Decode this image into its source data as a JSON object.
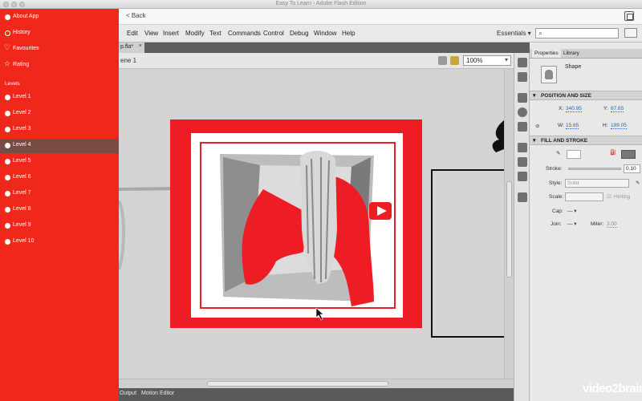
{
  "window": {
    "title": "Easy To Learn - Adobe Flash Edition"
  },
  "nav": {
    "back_label": "< Back"
  },
  "menu": {
    "items": [
      "Edit",
      "View",
      "Insert",
      "Modify",
      "Text",
      "Commands",
      "Control",
      "Debug",
      "Window",
      "Help"
    ],
    "workspace": "Essentials ▾",
    "search_placeholder": ""
  },
  "document": {
    "tab_label": "p.fla*",
    "close_glyph": "×",
    "scene_label": "ene 1",
    "zoom": "100%"
  },
  "stage": {
    "accent": "#ee1c25",
    "play_glyph": "▶"
  },
  "bottom_tabs": [
    "Output",
    "Motion Editor"
  ],
  "sidebar": {
    "top_items": [
      {
        "label": "About App",
        "icon": "info-icon"
      },
      {
        "label": "History",
        "icon": "clock-icon"
      },
      {
        "label": "Favourites",
        "icon": "heart-icon"
      },
      {
        "label": "Rating",
        "icon": "star-icon"
      }
    ],
    "section_title": "Levels",
    "levels": [
      "Level 1",
      "Level 2",
      "Level 3",
      "Level 4",
      "Level 5",
      "Level 6",
      "Level 7",
      "Level 8",
      "Level 9",
      "Level 10"
    ],
    "active_level": "Level 4",
    "color": "#f0281c"
  },
  "properties": {
    "tabs": [
      "Properties",
      "Library"
    ],
    "object_type": "Shape",
    "position_section": "POSITION AND SIZE",
    "x_label": "X:",
    "x_value": "340.95",
    "y_label": "Y:",
    "y_value": "87.65",
    "w_label": "W:",
    "w_value": "15.65",
    "h_label": "H:",
    "h_value": "199.05",
    "fill_section": "FILL AND STROKE",
    "stroke_label": "Stroke:",
    "stroke_value": "0.10",
    "style_label": "Style:",
    "style_value": "Solid",
    "scale_label": "Scale:",
    "hinting_label": "Hinting",
    "cap_label": "Cap:",
    "join_label": "Join:",
    "miter_label": "Miter:",
    "miter_value": "3.00"
  },
  "watermark": "video2brain"
}
